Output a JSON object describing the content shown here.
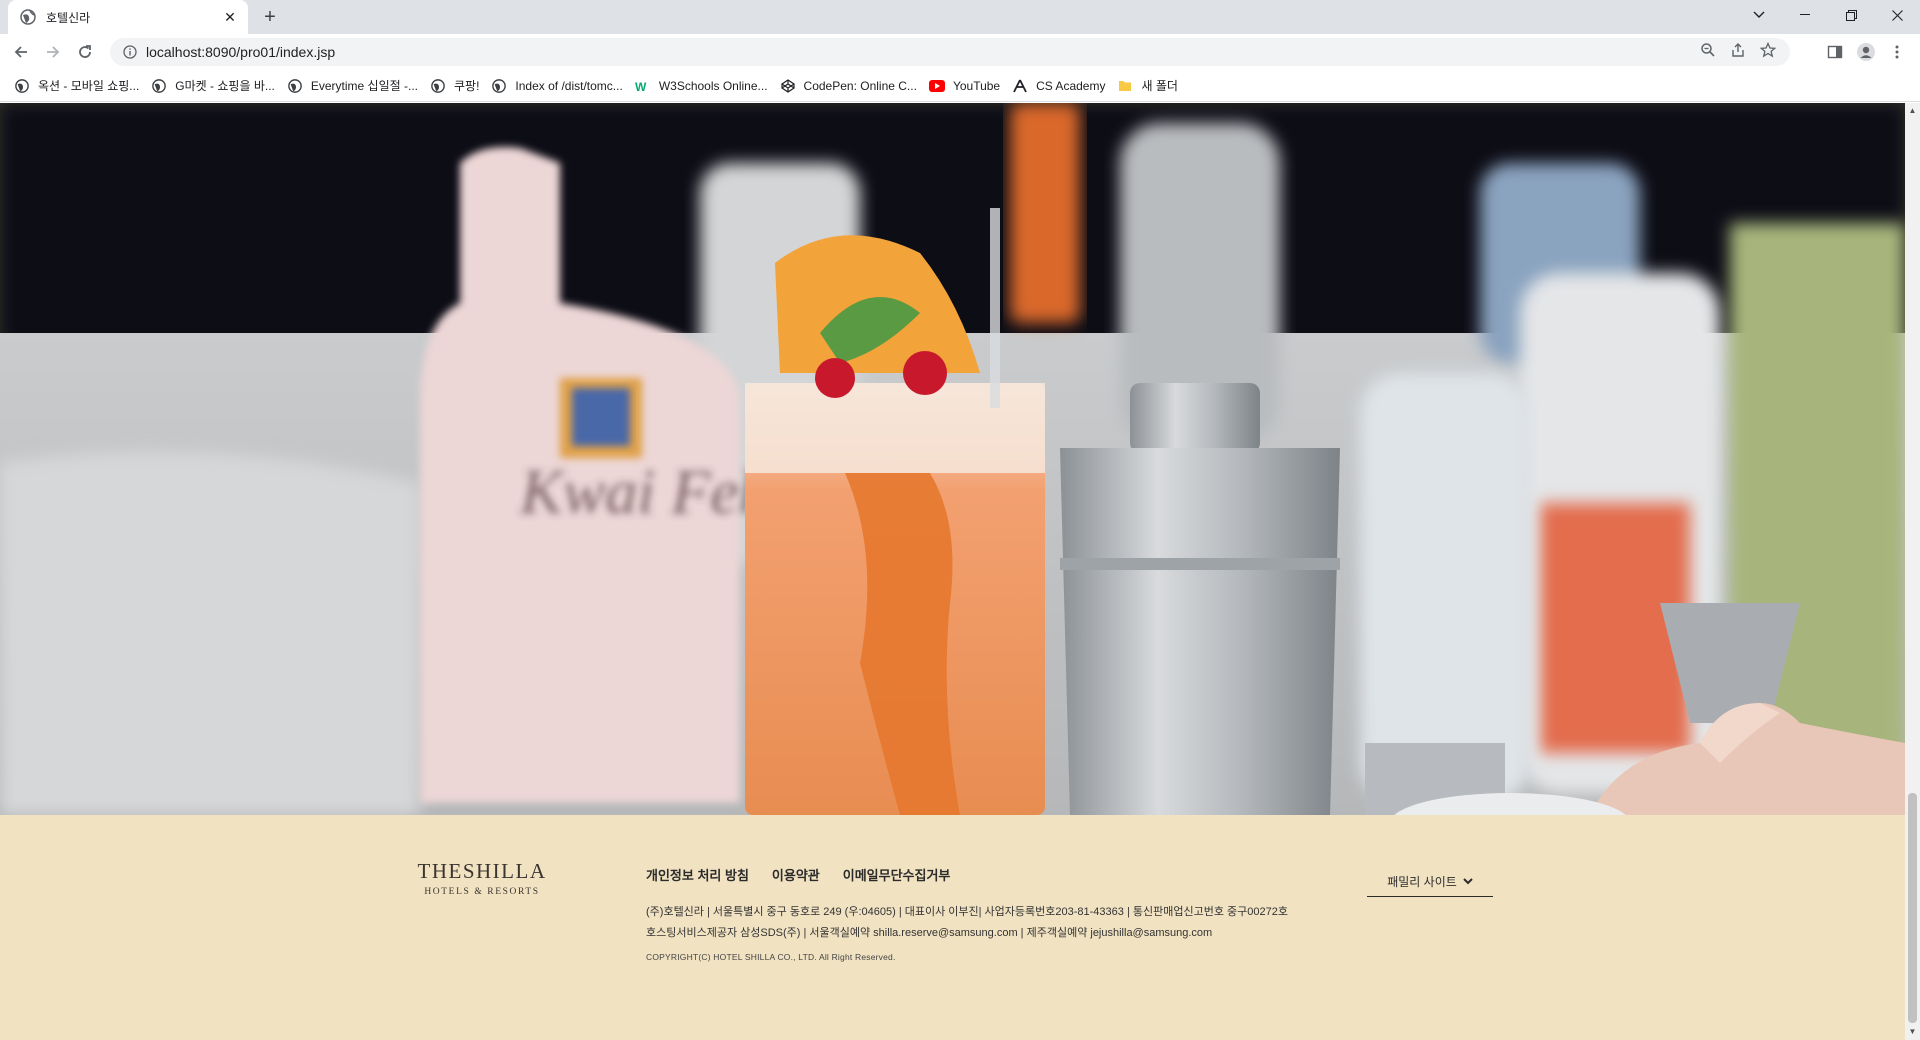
{
  "browser": {
    "tab_title": "호텔신라",
    "new_tab_label": "+",
    "url": "localhost:8090/pro01/index.jsp",
    "bookmarks": [
      {
        "label": "옥션 - 모바일 쇼핑...",
        "icon": "globe-icon"
      },
      {
        "label": "G마켓 - 쇼핑을 바...",
        "icon": "globe-icon"
      },
      {
        "label": "Everytime 십일절 -...",
        "icon": "globe-icon"
      },
      {
        "label": "쿠팡!",
        "icon": "globe-icon"
      },
      {
        "label": "Index of /dist/tomc...",
        "icon": "globe-icon"
      },
      {
        "label": "W3Schools Online...",
        "icon": "w3schools-icon"
      },
      {
        "label": "CodePen: Online C...",
        "icon": "codepen-icon"
      },
      {
        "label": "YouTube",
        "icon": "youtube-icon"
      },
      {
        "label": "CS Academy",
        "icon": "cs-academy-icon"
      },
      {
        "label": "새 폴더",
        "icon": "folder-icon"
      }
    ]
  },
  "footer": {
    "logo_line1": "THESHILLA",
    "logo_line2": "HOTELS & RESORTS",
    "links": [
      "개인정보 처리 방침",
      "이용약관",
      "이메일무단수집거부"
    ],
    "info_line1": "(주)호텔신라 | 서울특별시 중구 동호로 249 (우:04605) | 대표이사 이부진| 사업자등록번호203-81-43363 | 통신판매업신고번호 중구00272호",
    "info_line2": "호스팅서비스제공자 삼성SDS(주) | 서울객실예약 shilla.reserve@samsung.com | 제주객실예약 jejushilla@samsung.com",
    "copyright": "COPYRIGHT(C) HOTEL SHILLA CO., LTD. All Right Reserved.",
    "family_site_label": "패밀리 사이트"
  },
  "colors": {
    "footer_bg": "#f1e2c2",
    "chrome_bg": "#dee1e6"
  }
}
